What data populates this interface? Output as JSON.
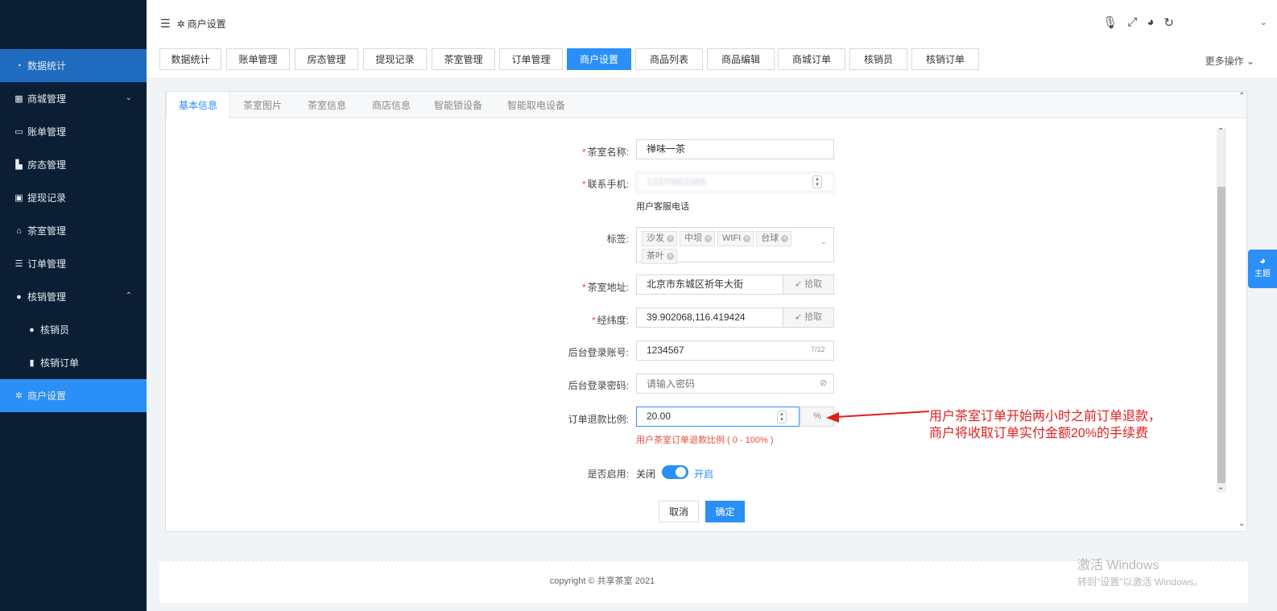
{
  "sidebar": {
    "items": [
      {
        "label": "数据统计",
        "icon": "dashboard-icon"
      },
      {
        "label": "商城管理",
        "icon": "shop-icon"
      },
      {
        "label": "账单管理",
        "icon": "bill-icon"
      },
      {
        "label": "房态管理",
        "icon": "chart-icon"
      },
      {
        "label": "提现记录",
        "icon": "cash-icon"
      },
      {
        "label": "茶室管理",
        "icon": "home-icon"
      },
      {
        "label": "订单管理",
        "icon": "list-icon"
      },
      {
        "label": "核销管理",
        "icon": "user-icon"
      },
      {
        "label": "核销员",
        "icon": "user-icon"
      },
      {
        "label": "核销订单",
        "icon": "trash-icon"
      },
      {
        "label": "商户设置",
        "icon": "gear-icon"
      }
    ]
  },
  "header": {
    "title": "商户设置"
  },
  "page_tabs": [
    "数据统计",
    "账单管理",
    "房态管理",
    "提现记录",
    "茶室管理",
    "订单管理",
    "商户设置",
    "商品列表",
    "商品编辑",
    "商城订单",
    "核销员",
    "核销订单"
  ],
  "more_ops": "更多操作",
  "inner_tabs": [
    "基本信息",
    "茶室图片",
    "茶室信息",
    "商店信息",
    "智能锁设备",
    "智能取电设备"
  ],
  "form": {
    "name": {
      "label": "茶室名称:",
      "value": "禅味一茶"
    },
    "phone": {
      "label": "联系手机:",
      "value": "13370903368",
      "help": "用户客服电话"
    },
    "tags": {
      "label": "标签:",
      "chips": [
        "沙发",
        "中坝",
        "WIFI",
        "台球",
        "茶叶"
      ]
    },
    "address": {
      "label": "茶室地址:",
      "value": "北京市东城区祈年大街",
      "btn": "拾取"
    },
    "latlng": {
      "label": "经纬度:",
      "value": "39.902068,116.419424",
      "btn": "拾取"
    },
    "account": {
      "label": "后台登录账号:",
      "value": "1234567",
      "counter": "7/12"
    },
    "password": {
      "label": "后台登录密码:",
      "placeholder": "请输入密码"
    },
    "refund": {
      "label": "订单退款比例:",
      "value": "20.00",
      "unit": "%",
      "help": "用户茶室订单退款比例 ( 0 - 100% )"
    },
    "enable": {
      "label": "是否启用:",
      "off": "关闭",
      "on": "开启",
      "state": true
    },
    "cancel": "取消",
    "confirm": "确定"
  },
  "annotation": {
    "line1": "用户茶室订单开始两小时之前订单退款，",
    "line2": "商户将收取订单实付金额20%的手续费"
  },
  "theme_tab": "主题",
  "footer": "copyright © 共享茶室 2021",
  "watermark": {
    "line1": "激活 Windows",
    "line2": "转到\"设置\"以激活 Windows。"
  },
  "colors": {
    "primary": "#2a8ff7",
    "sidebar": "#0b1e34",
    "annotation": "#e0201f"
  }
}
